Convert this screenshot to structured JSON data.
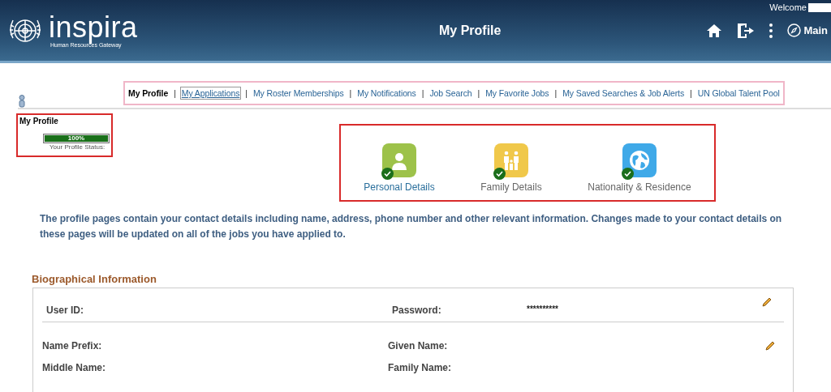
{
  "header": {
    "logo_text": "inspira",
    "logo_subtitle": "Human Resources Gateway",
    "title": "My Profile",
    "welcome": "Welcome",
    "main_button": "Main"
  },
  "nav_separator": "|",
  "nav": [
    {
      "label": "My Profile",
      "selected": true,
      "focused": false
    },
    {
      "label": "My Applications",
      "selected": false,
      "focused": true
    },
    {
      "label": "My Roster Memberships",
      "selected": false,
      "focused": false
    },
    {
      "label": "My Notifications",
      "selected": false,
      "focused": false
    },
    {
      "label": "Job Search",
      "selected": false,
      "focused": false
    },
    {
      "label": "My Favorite Jobs",
      "selected": false,
      "focused": false
    },
    {
      "label": "My Saved Searches & Job Alerts",
      "selected": false,
      "focused": false
    },
    {
      "label": "UN Global Talent Pool",
      "selected": false,
      "focused": false
    }
  ],
  "profile_status": {
    "title": "My Profile",
    "level": 1.0,
    "reading": "100%",
    "caption": "Your Profile Status:"
  },
  "sections": [
    {
      "kind": "person",
      "label": "Personal Details",
      "color": "#9dc24a",
      "completed": true,
      "selected": true
    },
    {
      "kind": "family",
      "label": "Family Details",
      "color": "#f0c84a",
      "completed": true,
      "selected": false
    },
    {
      "kind": "globe",
      "label": "Nationality & Residence",
      "color": "#3fa9e8",
      "completed": true,
      "selected": false
    }
  ],
  "intro": "The profile pages contain your contact details including name, address, phone number and other relevant information. Changes made to your contact details on these pages will be updated on all of the jobs you have applied to.",
  "biographical": {
    "heading": "Biographical Information",
    "groups": [
      {
        "fields": [
          {
            "label": "User ID:"
          },
          {
            "label": "Password:",
            "value": "**********"
          }
        ]
      },
      {
        "fields": [
          {
            "label": "Name Prefix:"
          },
          {
            "label": "Given Name:"
          },
          {
            "label": "Middle Name:"
          },
          {
            "label": "Family Name:"
          }
        ]
      }
    ]
  }
}
